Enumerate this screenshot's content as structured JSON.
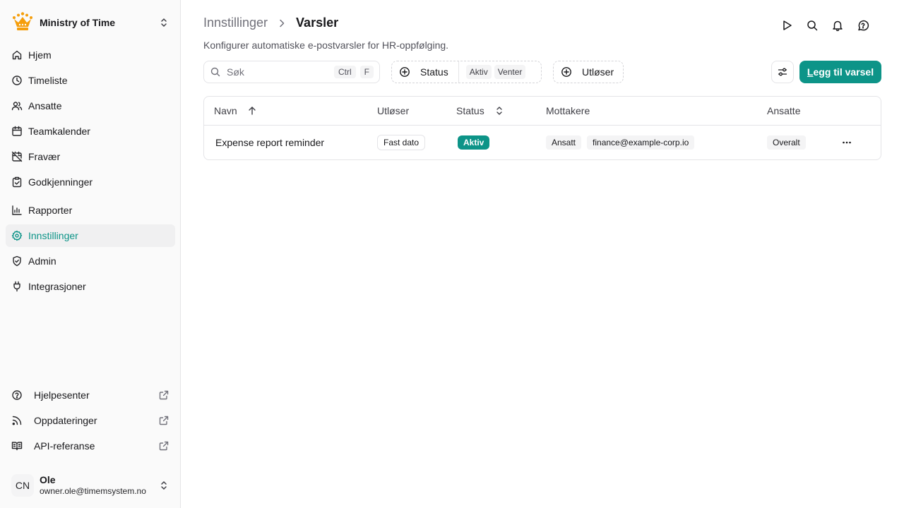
{
  "sidebar": {
    "org_name": "Ministry of Time",
    "nav": [
      {
        "label": "Hjem",
        "icon": "home-icon"
      },
      {
        "label": "Timeliste",
        "icon": "clock-icon"
      },
      {
        "label": "Ansatte",
        "icon": "users-icon"
      },
      {
        "label": "Teamkalender",
        "icon": "calendar-icon"
      },
      {
        "label": "Fravær",
        "icon": "calendar-off-icon"
      },
      {
        "label": "Godkjenninger",
        "icon": "clipboard-check-icon"
      },
      {
        "label": "Rapporter",
        "icon": "chart-icon"
      },
      {
        "label": "Innstillinger",
        "icon": "gear-icon",
        "active": true
      },
      {
        "label": "Admin",
        "icon": "shield-icon"
      },
      {
        "label": "Integrasjoner",
        "icon": "plug-icon"
      }
    ],
    "footer_links": [
      {
        "label": "Hjelpesenter",
        "icon": "help-circle-icon"
      },
      {
        "label": "Oppdateringer",
        "icon": "rss-icon"
      },
      {
        "label": "API-referanse",
        "icon": "book-icon"
      }
    ],
    "user": {
      "initials": "CN",
      "name": "Ole",
      "email": "owner.ole@timemsystem.no"
    }
  },
  "header": {
    "breadcrumb_parent": "Innstillinger",
    "breadcrumb_current": "Varsler",
    "subtitle": "Konfigurer automatiske e-postvarsler for HR-oppfølging."
  },
  "toolbar": {
    "search_placeholder": "Søk",
    "shortcut_ctrl": "Ctrl",
    "shortcut_key": "F",
    "status_filter": {
      "label": "Status",
      "values": [
        "Aktiv",
        "Venter"
      ]
    },
    "trigger_filter": {
      "label": "Utløser"
    },
    "add_button_first": "L",
    "add_button_rest": "egg til varsel"
  },
  "table": {
    "columns": [
      "Navn",
      "Utløser",
      "Status",
      "Mottakere",
      "Ansatte"
    ],
    "rows": [
      {
        "name": "Expense report reminder",
        "trigger": "Fast dato",
        "status": "Aktiv",
        "recipients": [
          "Ansatt",
          "finance@example-corp.io"
        ],
        "employees": "Overalt"
      }
    ]
  },
  "colors": {
    "accent": "#0d9488",
    "border": "#e4e4e7",
    "sidebar_bg": "#fafafa",
    "logo": "#f59e0b"
  }
}
